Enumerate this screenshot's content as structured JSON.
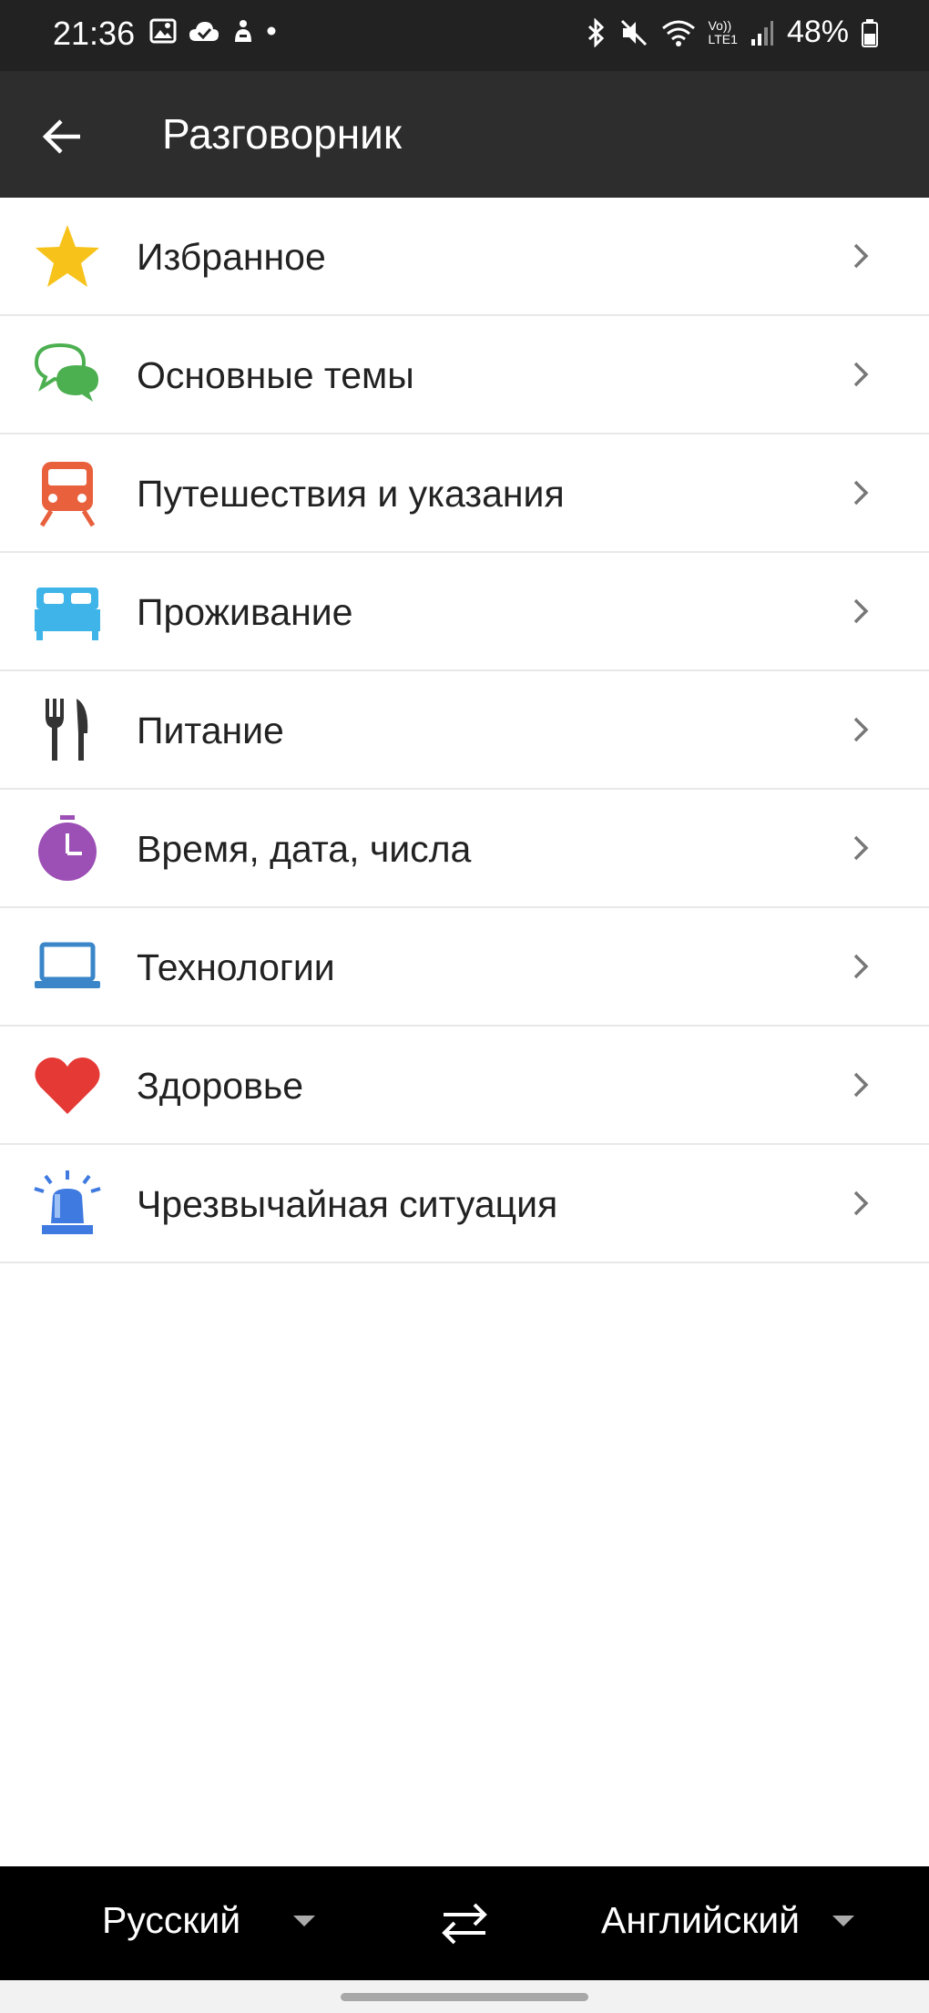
{
  "status_bar": {
    "time": "21:36",
    "battery": "48%",
    "network_label": "LTE1",
    "volte_label": "Vo))"
  },
  "app_bar": {
    "title": "Разговорник",
    "back_icon": "arrow-left-icon"
  },
  "topics": [
    {
      "label": "Избранное",
      "icon": "star-icon",
      "color": "#F7C31B"
    },
    {
      "label": "Основные темы",
      "icon": "chat-bubbles-icon",
      "color": "#4CAF50"
    },
    {
      "label": "Путешествия и указания",
      "icon": "train-icon",
      "color": "#E8603C"
    },
    {
      "label": "Проживание",
      "icon": "bed-icon",
      "color": "#3FB4E8"
    },
    {
      "label": "Питание",
      "icon": "fork-knife-icon",
      "color": "#333333"
    },
    {
      "label": "Время, дата, числа",
      "icon": "stopwatch-icon",
      "color": "#9C4FB5"
    },
    {
      "label": "Технологии",
      "icon": "laptop-icon",
      "color": "#3A86C8"
    },
    {
      "label": "Здоровье",
      "icon": "heart-icon",
      "color": "#E53935"
    },
    {
      "label": "Чрезвычайная ситуация",
      "icon": "siren-icon",
      "color": "#3F7AE0"
    }
  ],
  "language_bar": {
    "source_language": "Русский",
    "target_language": "Английский",
    "swap_icon": "swap-arrows-icon"
  }
}
